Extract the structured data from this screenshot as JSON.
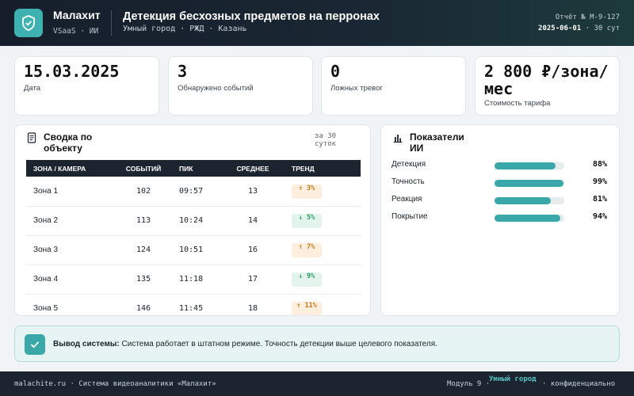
{
  "header": {
    "brand": "Малахит",
    "brand_sub": "VSaaS · ИИ",
    "title": "Детекция бесхозных предметов на перронах",
    "subtitle": "Умный город · РЖД · Казань",
    "report_label": "Отчёт № М-9-127",
    "report_date": "2025-06-01",
    "report_period": " · 30 сут"
  },
  "kpis": [
    {
      "value": "15.03.2025",
      "label": "Дата"
    },
    {
      "value": "3",
      "label": "Обнаружено событий"
    },
    {
      "value": "0",
      "label": "Ложных тревог"
    },
    {
      "value": "2 800 ₽/зона/мес",
      "label": "Стоимость тарифа"
    }
  ],
  "summary": {
    "title": "Сводка по объекту",
    "note": "за 30 суток",
    "columns": [
      "ЗОНА / КАМЕРА",
      "СОБЫТИЙ",
      "ПИК",
      "СРЕДНЕЕ",
      "ТРЕНД"
    ],
    "rows": [
      {
        "zone": "Зона 1",
        "events": "102",
        "peak": "09:57",
        "avg": "13",
        "trend": "↑ 3%",
        "dir": "up"
      },
      {
        "zone": "Зона 2",
        "events": "113",
        "peak": "10:24",
        "avg": "14",
        "trend": "↓ 5%",
        "dir": "down"
      },
      {
        "zone": "Зона 3",
        "events": "124",
        "peak": "10:51",
        "avg": "16",
        "trend": "↑ 7%",
        "dir": "up"
      },
      {
        "zone": "Зона 4",
        "events": "135",
        "peak": "11:18",
        "avg": "17",
        "trend": "↓ 9%",
        "dir": "down"
      },
      {
        "zone": "Зона 5",
        "events": "146",
        "peak": "11:45",
        "avg": "18",
        "trend": "↑ 11%",
        "dir": "up"
      }
    ]
  },
  "ai_metrics": {
    "title": "Показатели ИИ",
    "items": [
      {
        "label": "Детекция",
        "value": 88,
        "display": "88%"
      },
      {
        "label": "Точность",
        "value": 99,
        "display": "99%"
      },
      {
        "label": "Реакция",
        "value": 81,
        "display": "81%"
      },
      {
        "label": "Покрытие",
        "value": 94,
        "display": "94%"
      }
    ]
  },
  "conclusion": {
    "label": "Вывод системы:",
    "text": " Система работает в штатном режиме. Точность детекции выше целевого показателя."
  },
  "footer": {
    "left": "malachite.ru · Система видеоаналитики «Малахит»",
    "module": "Модуль 9 ·",
    "accent": "Умный город",
    "confidential": "· конфиденциально"
  },
  "colors": {
    "accent": "#3eb2b1",
    "trend_up_bg": "#fdeedd",
    "trend_up_text": "#c07a1c",
    "trend_down_bg": "#e2f4ec",
    "trend_down_text": "#2b9a63",
    "dark": "#1c2430"
  }
}
